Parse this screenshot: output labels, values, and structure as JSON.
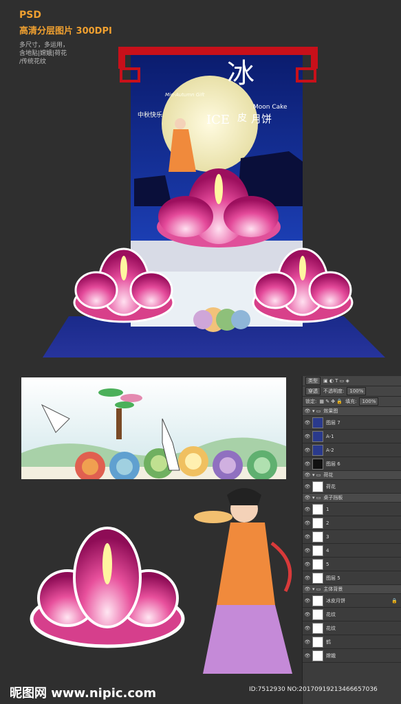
{
  "header": {
    "psd": "PSD",
    "dpi": "高清分层图片 300DPI",
    "notes": [
      "多尺寸，多运用，",
      "含地贴|嫦娥|荷花",
      "/传统花纹"
    ]
  },
  "poster": {
    "title_char": "冰",
    "ice": "ICE",
    "mooncake_char": "皮",
    "mooncake_word": "月饼",
    "moon_cake_en": "Moon Cake",
    "script": "Mid-Autumn Gift",
    "festival": "中秋快乐"
  },
  "layers_panel": {
    "kind_select": "类型",
    "blend_select": "穿透",
    "opacity_label": "不透明度:",
    "opacity_value": "100%",
    "lock_label": "锁定:",
    "fill_label": "填充:",
    "fill_value": "100%",
    "layers": [
      {
        "type": "group",
        "name": "效果图"
      },
      {
        "type": "layer",
        "name": "图层 7",
        "thumb": "blue"
      },
      {
        "type": "layer",
        "name": "A-1",
        "thumb": "blue"
      },
      {
        "type": "layer",
        "name": "A-2",
        "thumb": "blue"
      },
      {
        "type": "layer",
        "name": "图层 6",
        "thumb": "dark"
      },
      {
        "type": "group",
        "name": "荷花"
      },
      {
        "type": "layer",
        "name": "荷花",
        "thumb": "white"
      },
      {
        "type": "group",
        "name": "桌子挡板"
      },
      {
        "type": "layer",
        "name": "1",
        "thumb": "white"
      },
      {
        "type": "layer",
        "name": "2",
        "thumb": "white"
      },
      {
        "type": "layer",
        "name": "3",
        "thumb": "white"
      },
      {
        "type": "layer",
        "name": "4",
        "thumb": "white"
      },
      {
        "type": "layer",
        "name": "5",
        "thumb": "white"
      },
      {
        "type": "layer",
        "name": "图层 5",
        "thumb": "white"
      },
      {
        "type": "group",
        "name": "主体背景"
      },
      {
        "type": "layer",
        "name": "冰皮月饼",
        "thumb": "white",
        "locked": true
      },
      {
        "type": "layer",
        "name": "花纹",
        "thumb": "white"
      },
      {
        "type": "layer",
        "name": "花纹",
        "thumb": "white"
      },
      {
        "type": "layer",
        "name": "鹤",
        "thumb": "white"
      },
      {
        "type": "layer",
        "name": "嫦娥",
        "thumb": "white"
      }
    ]
  },
  "footer": {
    "logo": "昵图网 www.nipic.com",
    "id_text": "ID:7512930 NO:20170919213466657036"
  }
}
